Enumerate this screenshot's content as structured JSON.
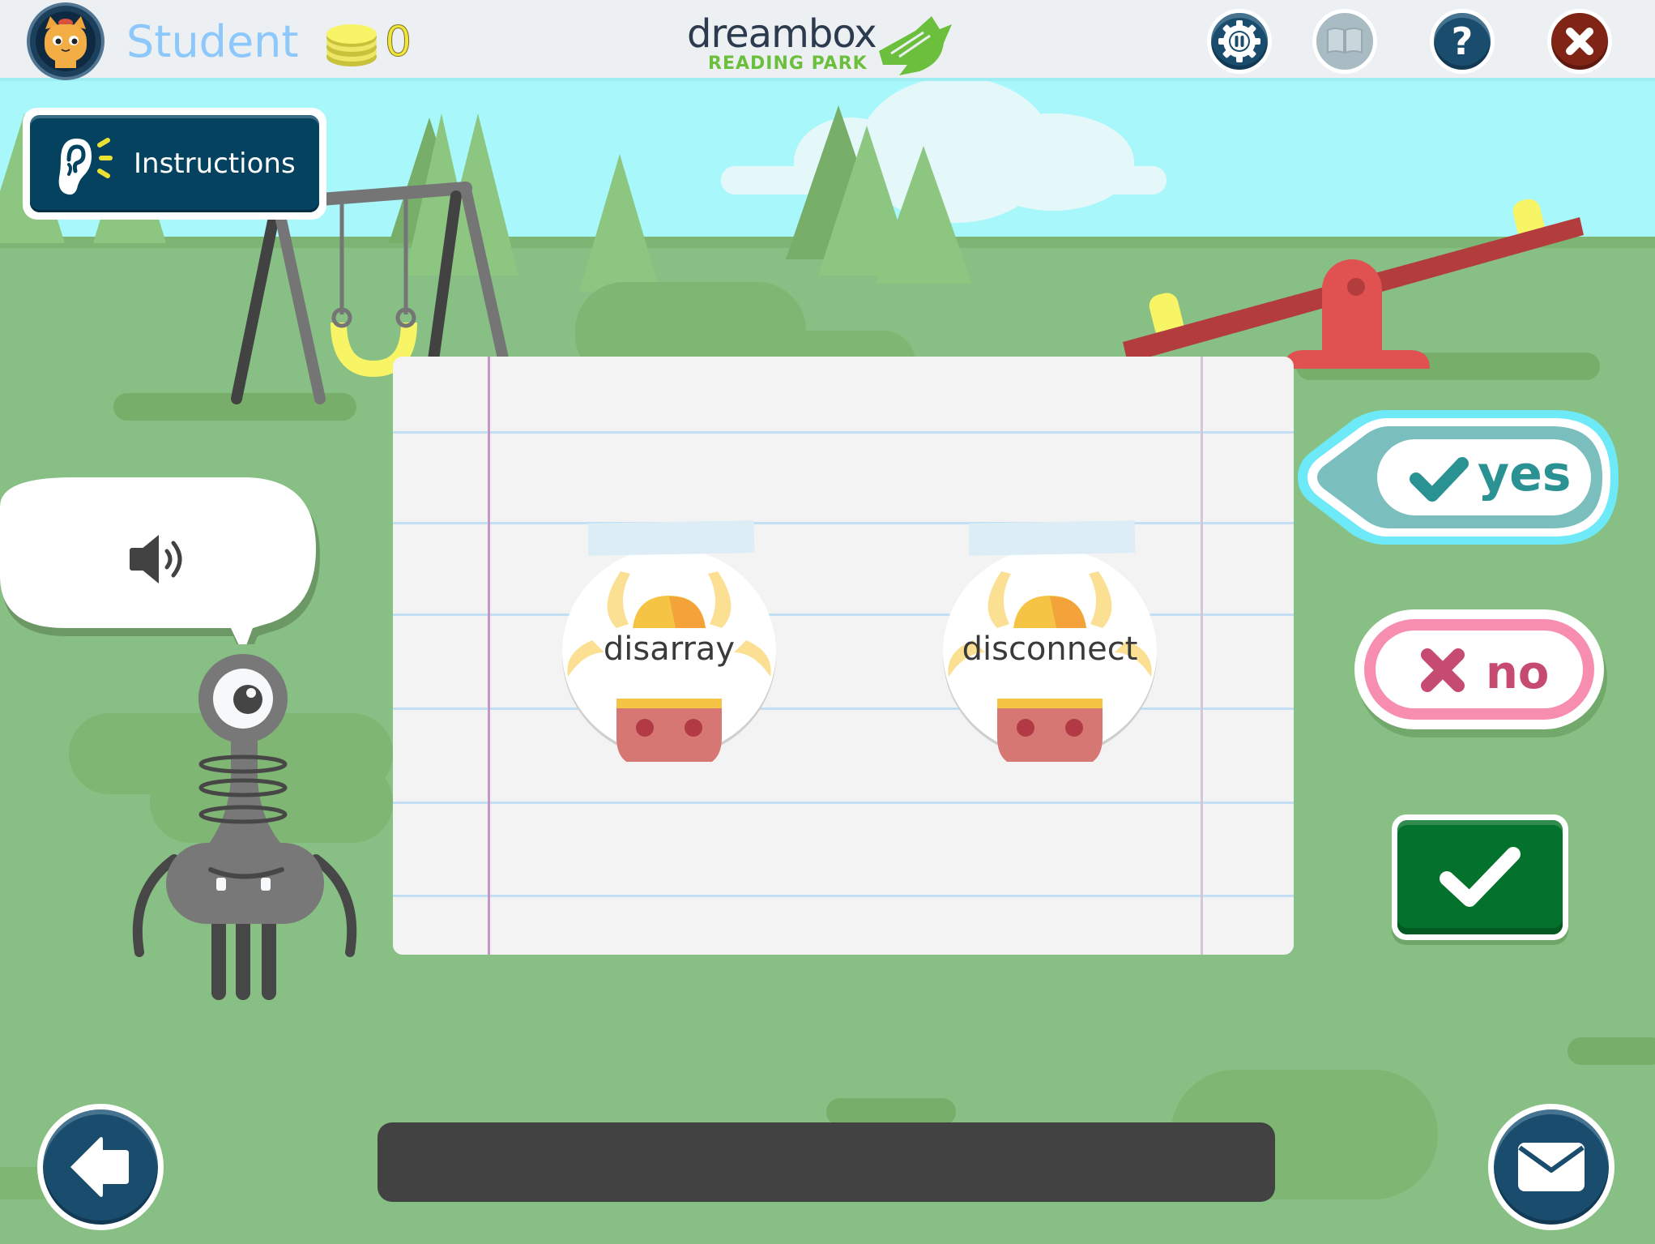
{
  "header": {
    "user_name": "Student",
    "coin_count": "0",
    "logo": {
      "brand": "dreambox",
      "product": "READING PARK"
    },
    "buttons": [
      {
        "name": "settings-pause",
        "icon": "gear-pause-icon",
        "enabled": true
      },
      {
        "name": "book",
        "icon": "book-icon",
        "enabled": false
      },
      {
        "name": "help",
        "icon": "question-icon",
        "enabled": true
      },
      {
        "name": "close",
        "icon": "close-icon",
        "enabled": true
      }
    ]
  },
  "instructions": {
    "label": "Instructions",
    "icon": "ear-sound-icon"
  },
  "speech_bubble": {
    "icon": "speaker-icon"
  },
  "activity": {
    "words": [
      "disarray",
      "disconnect"
    ]
  },
  "answers": {
    "yes_label": "yes",
    "no_label": "no",
    "selected": "yes"
  },
  "submit": {
    "icon": "checkmark-icon"
  },
  "footer": {
    "back_icon": "arrow-left-icon",
    "mail_icon": "mail-icon"
  },
  "colors": {
    "navy": "#1a4d6d",
    "yes_teal": "#2b9293",
    "yes_highlight": "#6ee9f7",
    "no_pink": "#c64b71",
    "submit_green": "#03722c",
    "grass": "#88bf84",
    "sky": "#a8f8fb"
  }
}
